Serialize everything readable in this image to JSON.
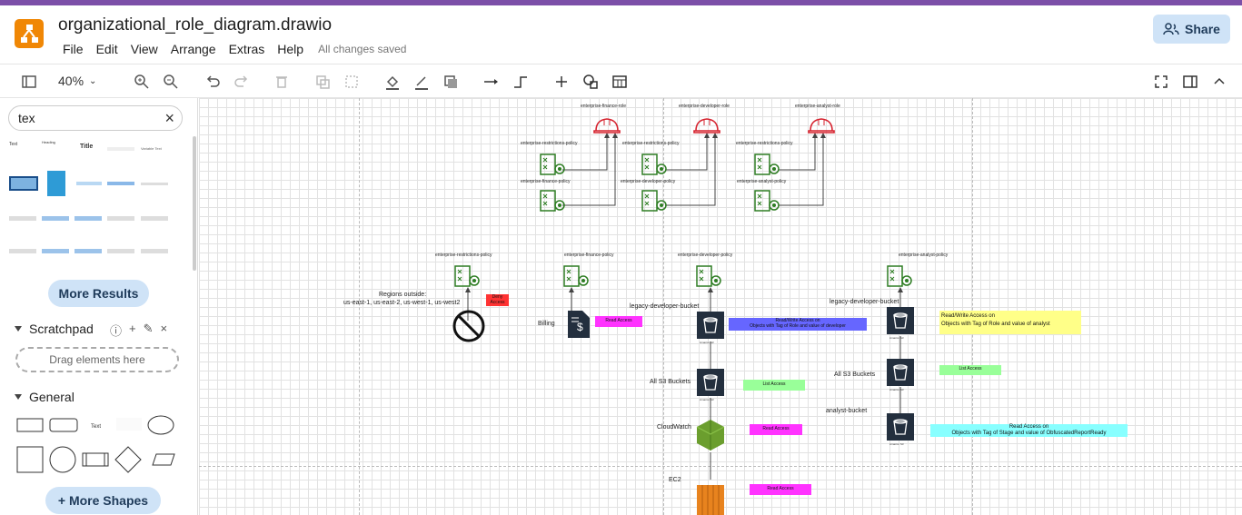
{
  "app": {
    "title": "organizational_role_diagram.drawio",
    "menu": [
      "File",
      "Edit",
      "View",
      "Arrange",
      "Extras",
      "Help"
    ],
    "status": "All changes saved",
    "share_label": "Share",
    "zoom": "40%"
  },
  "sidebar": {
    "search_value": "tex",
    "more_results": "More Results",
    "scratchpad_title": "Scratchpad",
    "drag_hint": "Drag elements here",
    "general_title": "General",
    "more_shapes": "+ More Shapes",
    "thumb_labels": [
      "Text",
      "Heading",
      "Title",
      "Variable Text"
    ]
  },
  "diagram": {
    "roles": [
      "enterprise-finance-role",
      "enterprise-developer-role",
      "enterprise-analyst-role"
    ],
    "top_policies": [
      [
        "enterprise-restrictions-policy",
        "enterprise-finance-policy"
      ],
      [
        "enterprise-restrictions-policy",
        "enterprise-developer-policy"
      ],
      [
        "enterprise-restrictions-policy",
        "enterprise-analyst-policy"
      ]
    ],
    "lower_policies": [
      "enterprise-restrictions-policy",
      "enterprise-finance-policy",
      "enterprise-developer-policy",
      "enterprise-analyst-policy"
    ],
    "regions_text": [
      "Regions outside:",
      "us-east-1, us-east-2, us-west-1, us-west2"
    ],
    "deny_access": [
      "Deny",
      "Access"
    ],
    "billing": "Billing",
    "read_access": "Read Access",
    "legacy_bucket": "legacy-developer-bucket",
    "dev_rw_note": [
      "Read/Write Access on",
      "Objects with Tag of Role and value of developer"
    ],
    "analyst_rw_note": [
      "Read/Write Access on",
      "Objects with Tag of Role and value of analyst"
    ],
    "all_s3": "All S3 Buckets",
    "list_access": "List Access",
    "cloudwatch": "CloudWatch",
    "analyst_bucket": "analyst-bucket",
    "analyst_read_note": [
      "Read Access on",
      "Objects with Tag of Stage and value of ObfuscatedReportReady"
    ],
    "ec2": "EC2",
    "s3_caption": "Amazon S3",
    "colors": {
      "role_red": "#d6232f",
      "policy_green": "#2e7d23",
      "magenta": "#ff33ff",
      "blue": "#6666ff",
      "yellow": "#ffff88",
      "light_green": "#99ff99",
      "cyan": "#88ffff",
      "red_box": "#ff3333"
    }
  }
}
